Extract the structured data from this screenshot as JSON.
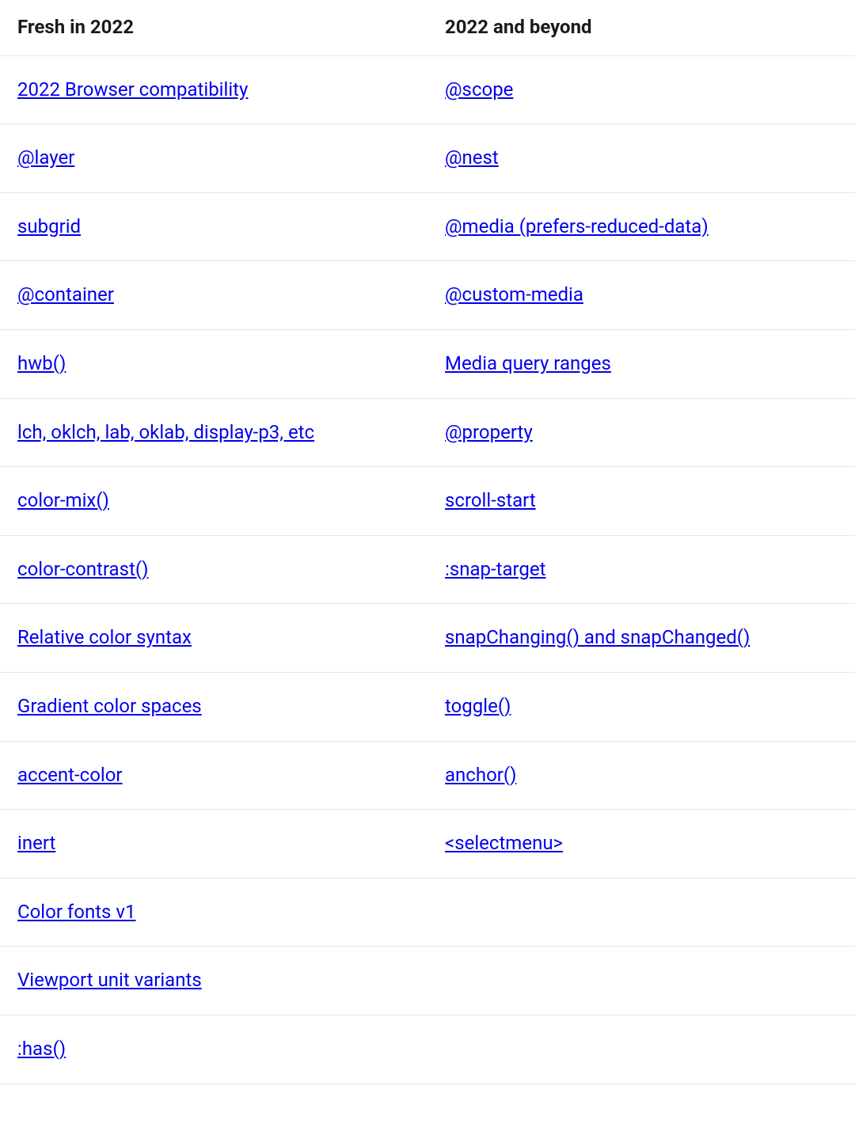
{
  "table": {
    "headers": [
      "Fresh in 2022",
      "2022 and beyond"
    ],
    "rows": [
      [
        "2022 Browser compatibility",
        "@scope"
      ],
      [
        "@layer",
        "@nest"
      ],
      [
        "subgrid",
        "@media (prefers-reduced-data)"
      ],
      [
        "@container",
        "@custom-media"
      ],
      [
        "hwb()",
        "Media query ranges"
      ],
      [
        "lch, oklch, lab, oklab, display-p3, etc",
        "@property"
      ],
      [
        "color-mix()",
        "scroll-start"
      ],
      [
        "color-contrast()",
        ":snap-target"
      ],
      [
        "Relative color syntax",
        "snapChanging() and snapChanged()"
      ],
      [
        "Gradient color spaces",
        "toggle()"
      ],
      [
        "accent-color",
        "anchor()"
      ],
      [
        "inert",
        "<selectmenu>"
      ],
      [
        "Color fonts v1",
        ""
      ],
      [
        "Viewport unit variants",
        ""
      ],
      [
        ":has()",
        ""
      ]
    ]
  }
}
